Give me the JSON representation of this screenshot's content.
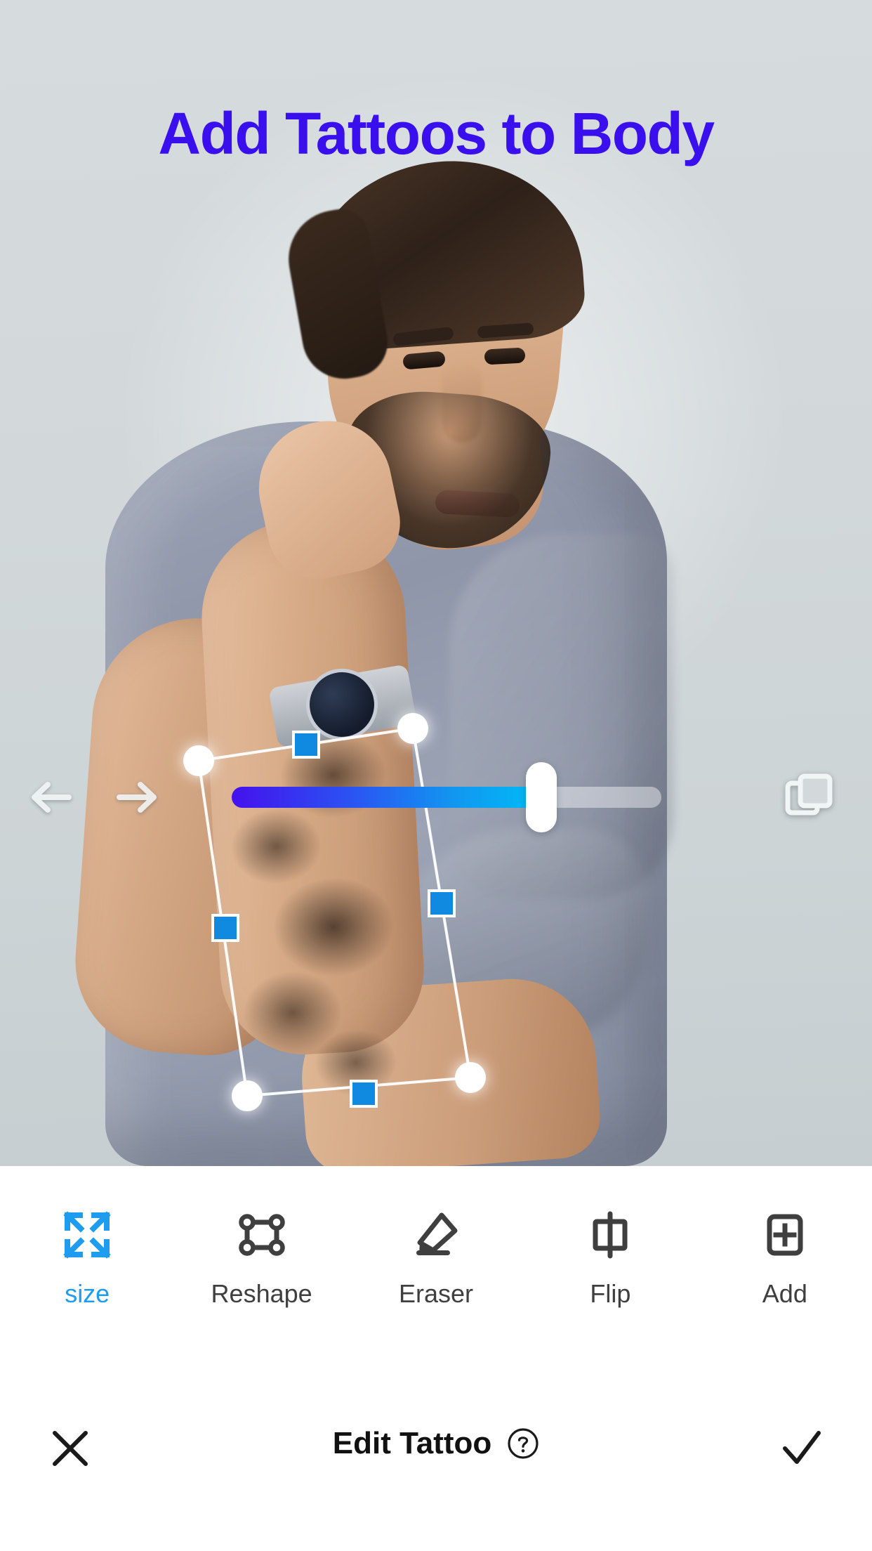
{
  "header": {
    "title": "Add Tattoos to Body",
    "title_color": "#3a0fee"
  },
  "canvas": {
    "background_color": "#d3d9db",
    "selection": {
      "handle_circle_color": "#ffffff",
      "handle_square_color": "#1089e0",
      "mesh_line_color": "#ffffff"
    },
    "controls": {
      "undo_icon": "arrow-left-icon",
      "redo_icon": "arrow-right-icon",
      "layers_icon": "layers-icon",
      "slider": {
        "name": "opacity-slider",
        "value": 72,
        "min": 0,
        "max": 100,
        "gradient_start": "#4411ee",
        "gradient_end": "#00bcf7",
        "thumb_color": "#ffffff"
      }
    }
  },
  "toolbar": {
    "active_color": "#1e9cf0",
    "inactive_color": "#3f3f3f",
    "items": [
      {
        "id": "size",
        "label": "size",
        "icon": "expand-arrows-icon",
        "active": true
      },
      {
        "id": "reshape",
        "label": "Reshape",
        "icon": "reshape-nodes-icon",
        "active": false
      },
      {
        "id": "eraser",
        "label": "Eraser",
        "icon": "eraser-icon",
        "active": false
      },
      {
        "id": "flip",
        "label": "Flip",
        "icon": "flip-horizontal-icon",
        "active": false
      },
      {
        "id": "add",
        "label": "Add",
        "icon": "add-plus-box-icon",
        "active": false
      }
    ]
  },
  "footer": {
    "close_icon": "close-x-icon",
    "title": "Edit Tattoo",
    "help_icon": "question-circle-icon",
    "done_icon": "check-icon"
  }
}
